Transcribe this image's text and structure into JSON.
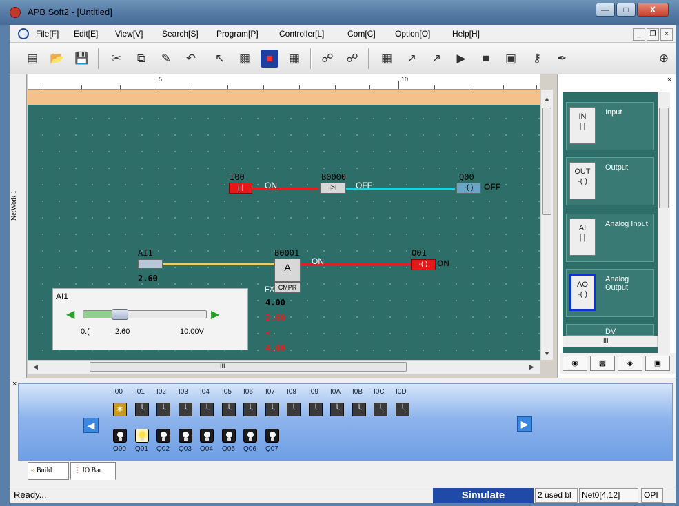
{
  "window": {
    "title": "APB Soft2 - [Untitled]",
    "min_glyph": "—",
    "max_glyph": "□",
    "close_glyph": "X"
  },
  "menu": {
    "items": [
      "File[F]",
      "Edit[E]",
      "View[V]",
      "Search[S]",
      "Program[P]",
      "Controller[L]",
      "Com[C]",
      "Option[O]",
      "Help[H]"
    ],
    "mdi_min": "_",
    "mdi_restore": "❐",
    "mdi_close": "×"
  },
  "toolbar": {
    "icons": [
      "new-file-icon",
      "open-folder-icon",
      "save-icon",
      "cut-icon",
      "copy-icon",
      "paste-icon",
      "undo-icon",
      "pointer-icon",
      "select-block-icon",
      "simulate-icon",
      "io-panel-icon",
      "link-read-icon",
      "link-write-icon",
      "upload-icon",
      "download-icon",
      "download-alt-icon",
      "run-icon",
      "stop-icon",
      "monitor-icon",
      "key-icon",
      "pen-icon",
      "zoom-in-icon"
    ]
  },
  "ruler": {
    "marks": [
      "5",
      "10"
    ],
    "close": "×"
  },
  "network": {
    "label": "NetWork 1"
  },
  "ladder": {
    "row1": {
      "contact": {
        "name": "I00",
        "state": "ON",
        "glyph": "| |"
      },
      "block": {
        "name": "B0000",
        "state": "OFF",
        "glyph": "|>I"
      },
      "coil": {
        "name": "Q00",
        "state": "OFF",
        "glyph": "-( )"
      }
    },
    "row2": {
      "analog": {
        "name": "AI1",
        "value": "2.60"
      },
      "block": {
        "name": "B0001",
        "state": "ON",
        "func": "CMPR",
        "fx": "FX",
        "glyph": "A"
      },
      "coil": {
        "name": "Q01",
        "state": "ON",
        "glyph": "-( )"
      },
      "values": [
        "4.00",
        "2.60",
        "<",
        "4.00"
      ]
    }
  },
  "slider": {
    "title": "AI1",
    "min": "0.(",
    "current": "2.60",
    "max": "10.00V",
    "fraction": 0.26
  },
  "palette": {
    "cards": [
      {
        "icon_text": "IN",
        "label": "Input"
      },
      {
        "icon_text": "OUT",
        "label": "Output"
      },
      {
        "icon_text": "AI",
        "label": "Analog Input"
      },
      {
        "icon_text": "AO",
        "label": "Analog Output"
      },
      {
        "icon_text": "",
        "label": "DV"
      }
    ],
    "hscroll_label": "III"
  },
  "iobar": {
    "inputs": [
      "I00",
      "I01",
      "I02",
      "I03",
      "I04",
      "I05",
      "I06",
      "I07",
      "I08",
      "I09",
      "I0A",
      "I0B",
      "I0C",
      "I0D"
    ],
    "outputs": [
      "Q00",
      "Q01",
      "Q02",
      "Q03",
      "Q04",
      "Q05",
      "Q06",
      "Q07"
    ],
    "active_input": "I00",
    "active_output": "Q01"
  },
  "tabs": {
    "build": "Build",
    "iobar": "IO Bar"
  },
  "scroll": {
    "hlabel": "III"
  },
  "status": {
    "ready": "Ready...",
    "mode": "Simulate",
    "used": "2 used bl",
    "net": "Net0[4,12]",
    "extra": "OPI"
  }
}
